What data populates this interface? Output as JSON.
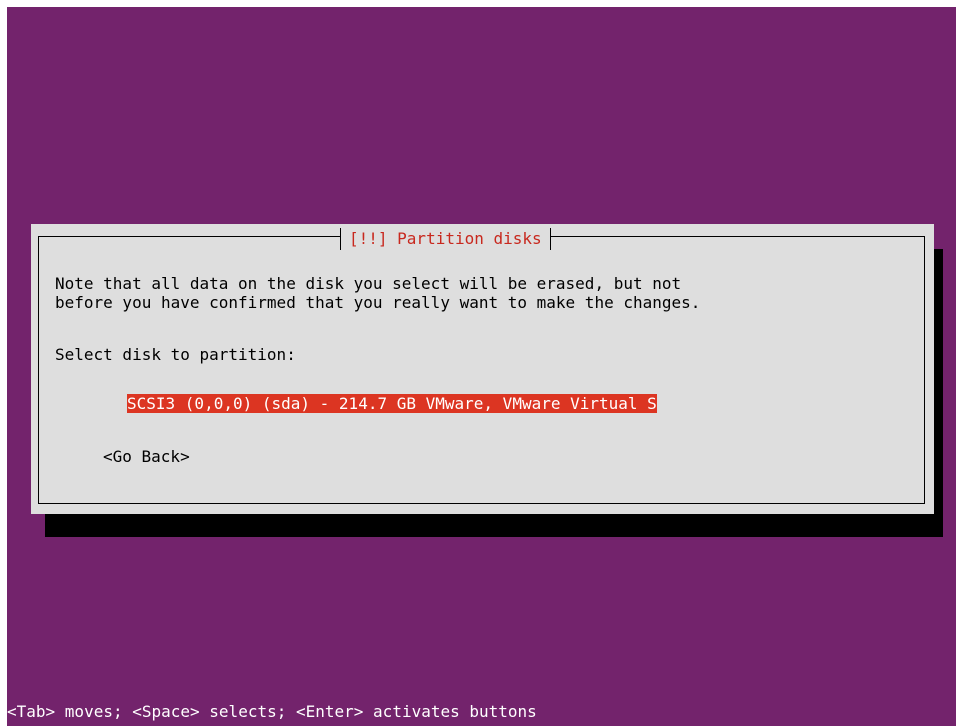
{
  "dialog": {
    "title": "[!!] Partition disks",
    "message": "Note that all data on the disk you select will be erased, but not\nbefore you have confirmed that you really want to make the changes.",
    "select_label": "Select disk to partition:",
    "disks": [
      {
        "label": "SCSI3 (0,0,0) (sda) - 214.7 GB VMware, VMware Virtual S",
        "selected": true
      }
    ],
    "go_back_label": "<Go Back>"
  },
  "footer": {
    "help": "<Tab> moves; <Space> selects; <Enter> activates buttons"
  },
  "colors": {
    "background": "#73236c",
    "dialog": "#dedede",
    "title": "#c8281e",
    "selection": "#dc3522",
    "shadow": "#000000"
  }
}
